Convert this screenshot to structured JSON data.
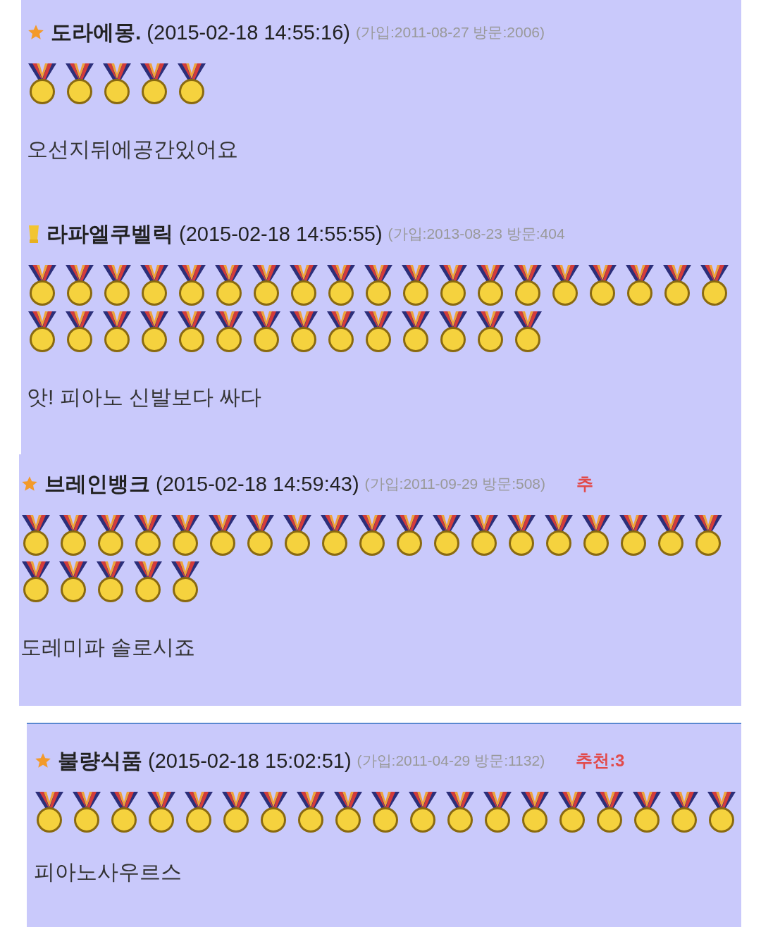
{
  "comments": [
    {
      "kind": "star",
      "name": "도라에몽.",
      "time": "(2015-02-18 14:55:16)",
      "meta": "(가입:2011-08-27 방문:2006)",
      "medal_rows": [
        {
          "stars": 5
        }
      ],
      "text": "오선지뒤에공간있어요"
    },
    {
      "kind": "cup",
      "name": "라파엘쿠벨릭",
      "time": "(2015-02-18 14:55:55)",
      "meta": "(가입:2013-08-23 방문:404",
      "medal_rows": [
        {
          "medals": [
            {
              "kind": "medal"
            },
            {
              "kind": "medal"
            },
            {
              "kind": "medal"
            },
            {
              "kind": "medal"
            },
            {
              "kind": "medal"
            },
            {
              "kind": "medal"
            },
            {
              "kind": "medal"
            },
            {
              "kind": "medal"
            },
            {
              "kind": "medal"
            },
            {
              "kind": "medal"
            },
            {
              "kind": "medal"
            },
            {
              "kind": "medal"
            },
            {
              "kind": "medal"
            },
            {
              "kind": "medal"
            },
            {
              "kind": "medal"
            },
            {
              "kind": "medal"
            },
            {
              "kind": "medal"
            },
            {
              "kind": "medal"
            },
            {
              "kind": "medal"
            }
          ]
        },
        {
          "medals": [
            {
              "kind": "medal"
            },
            {
              "kind": "medal"
            },
            {
              "kind": "medal"
            },
            {
              "kind": "medal"
            },
            {
              "kind": "medal"
            },
            {
              "kind": "medal"
            },
            {
              "kind": "medal"
            },
            {
              "kind": "medal"
            },
            {
              "kind": "medal"
            },
            {
              "kind": "medal"
            },
            {
              "kind": "medal"
            },
            {
              "kind": "medal"
            },
            {
              "kind": "medal"
            },
            {
              "kind": "medal"
            }
          ]
        }
      ],
      "text": "앗! 피아노 신발보다 싸다"
    },
    {
      "kind": "star",
      "name": "브레인뱅크",
      "time": "(2015-02-18 14:59:43)",
      "meta": "(가입:2011-09-29 방문:508)",
      "recommend": "추",
      "medal_rows": [
        {
          "medals": [
            {
              "kind": "medal"
            },
            {
              "kind": "medal"
            },
            {
              "kind": "medal"
            },
            {
              "kind": "medal"
            },
            {
              "kind": "medal"
            },
            {
              "kind": "medal"
            },
            {
              "kind": "medal"
            },
            {
              "kind": "medal"
            },
            {
              "kind": "medal"
            },
            {
              "kind": "medal"
            },
            {
              "kind": "medal"
            },
            {
              "kind": "medal"
            },
            {
              "kind": "medal"
            },
            {
              "kind": "medal"
            },
            {
              "kind": "medal"
            },
            {
              "kind": "medal"
            },
            {
              "kind": "medal"
            },
            {
              "kind": "medal"
            },
            {
              "kind": "medal"
            }
          ]
        },
        {
          "stars": 5
        }
      ],
      "text": "도레미파 솔로시죠"
    },
    {
      "kind": "star",
      "name": "불량식품",
      "time": "(2015-02-18 15:02:51)",
      "meta": "(가입:2011-04-29 방문:1132)",
      "recommend": "추천:3",
      "medal_rows": [
        {
          "medals": [
            {
              "kind": "medal"
            },
            {
              "kind": "medal"
            },
            {
              "kind": "medal"
            },
            {
              "kind": "medal"
            },
            {
              "kind": "medal"
            },
            {
              "kind": "medal"
            },
            {
              "kind": "medal"
            },
            {
              "kind": "medal"
            },
            {
              "kind": "medal"
            },
            {
              "kind": "medal"
            },
            {
              "kind": "medal"
            },
            {
              "kind": "medal"
            },
            {
              "kind": "medal"
            },
            {
              "kind": "medal"
            },
            {
              "kind": "medal"
            },
            {
              "kind": "medal"
            },
            {
              "kind": "medal"
            },
            {
              "kind": "medal"
            },
            {
              "kind": "medal"
            }
          ]
        }
      ],
      "text": "피아노사우르스"
    }
  ]
}
